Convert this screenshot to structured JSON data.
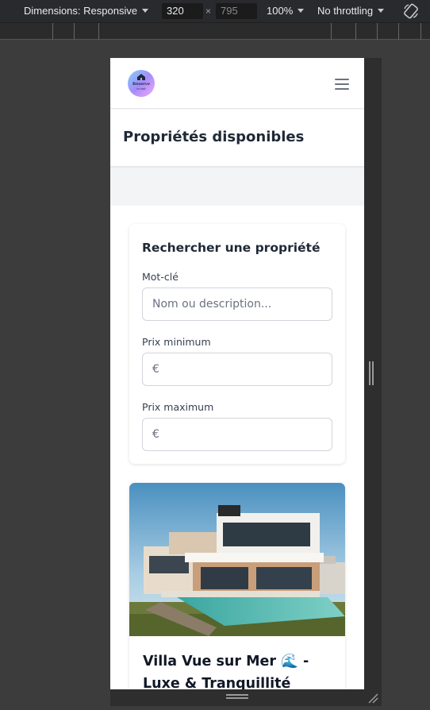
{
  "devtools": {
    "dimensions_label": "Dimensions: Responsive",
    "width_value": "320",
    "times_symbol": "×",
    "height_placeholder": "795",
    "zoom_label": "100%",
    "throttling_label": "No throttling"
  },
  "site": {
    "logo_line1": "Réserve",
    "logo_line2": "un toit",
    "page_title": "Propriétés disponibles"
  },
  "search": {
    "title": "Rechercher une propriété",
    "keyword_label": "Mot-clé",
    "keyword_placeholder": "Nom ou description...",
    "min_price_label": "Prix minimum",
    "max_price_label": "Prix maximum",
    "currency_symbol": "€"
  },
  "properties": [
    {
      "title": "Villa Vue sur Mer 🌊 - Luxe & Tranquillité"
    }
  ],
  "colors": {
    "devtools_bg": "#292a2d",
    "page_bg": "#f3f4f6",
    "text_primary": "#1f2937"
  }
}
